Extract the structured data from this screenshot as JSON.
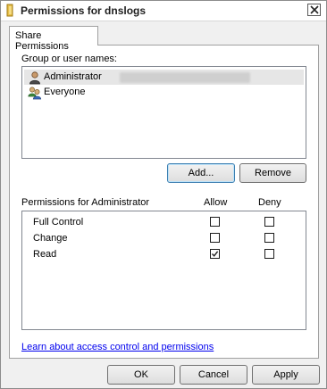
{
  "window": {
    "title": "Permissions for dnslogs",
    "close_glyph": "✕"
  },
  "tabs": [
    {
      "label": "Share Permissions",
      "selected": true
    }
  ],
  "users": {
    "label": "Group or user names:",
    "items": [
      {
        "name": "Administrator",
        "icon": "user-icon",
        "selected": true,
        "detail_obscured": true
      },
      {
        "name": "Everyone",
        "icon": "group-icon",
        "selected": false
      }
    ]
  },
  "buttons": {
    "add": "Add...",
    "remove": "Remove",
    "ok": "OK",
    "cancel": "Cancel",
    "apply": "Apply"
  },
  "permissions": {
    "header": "Permissions for Administrator",
    "allow_header": "Allow",
    "deny_header": "Deny",
    "rows": [
      {
        "name": "Full Control",
        "allow": false,
        "deny": false
      },
      {
        "name": "Change",
        "allow": false,
        "deny": false
      },
      {
        "name": "Read",
        "allow": true,
        "deny": false
      }
    ]
  },
  "help_link": "Learn about access control and permissions",
  "colors": {
    "link": "#0000ee",
    "selection": "#e6e6e6",
    "dialog_background": "#f0f0f0"
  }
}
